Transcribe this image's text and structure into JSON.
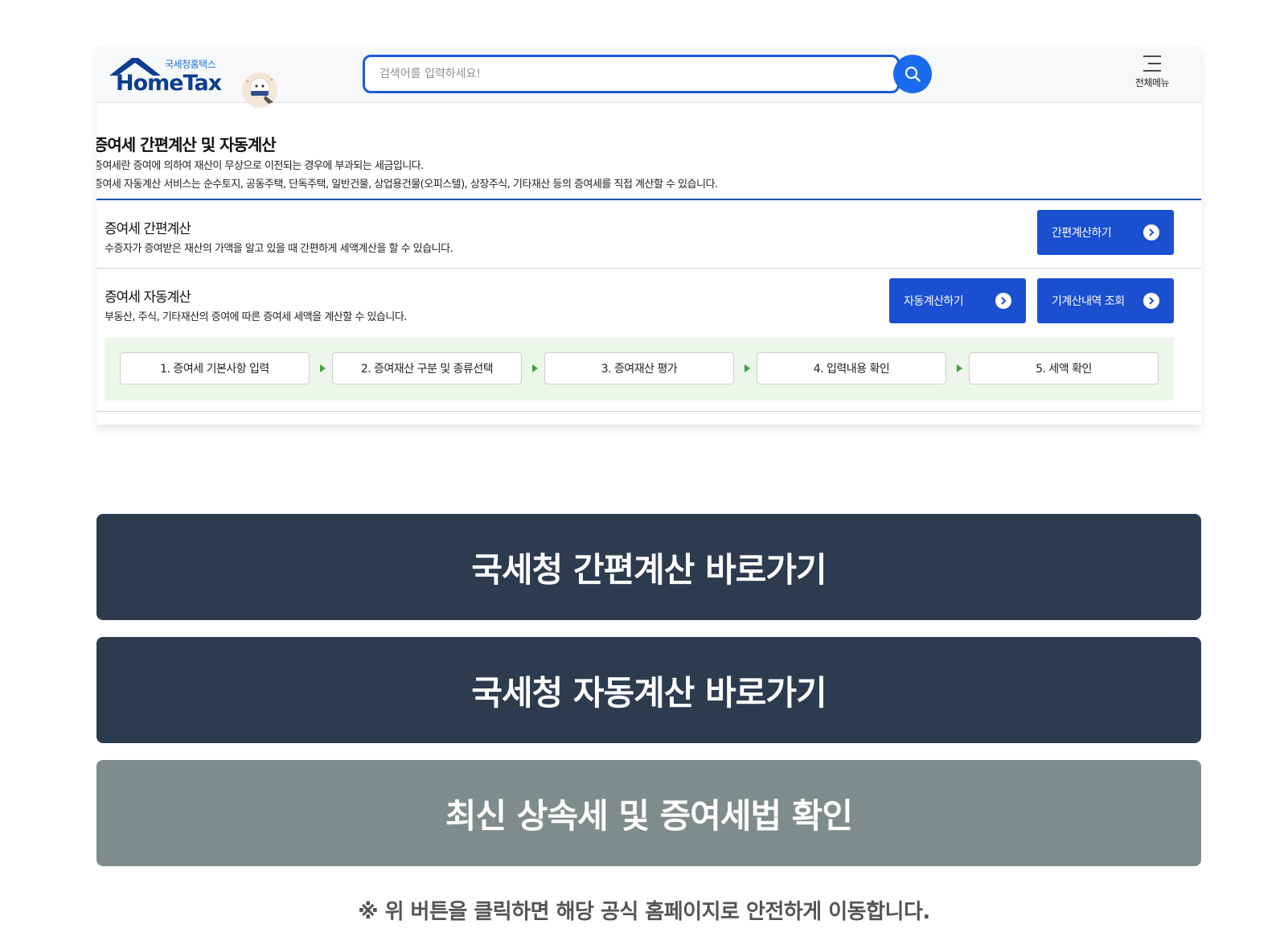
{
  "header": {
    "logo_sub": "국세청홈택스",
    "logo_main": "HomeTax",
    "search_placeholder": "검색어를 입력하세요!",
    "menu_label": "전체메뉴"
  },
  "intro": {
    "title": "증여세 간편계산 및 자동계산",
    "desc1": "증여세란 증여에 의하여 재산이 무상으로 이전되는 경우에 부과되는 세금입니다.",
    "desc2": "증여세 자동계산 서비스는 순수토지, 공동주택, 단독주택, 일반건물, 상업용건물(오피스텔), 상장주식, 기타재산 등의 증여세를 직접 계산할 수 있습니다."
  },
  "simple_calc": {
    "title": "증여세 간편계산",
    "desc": "수증자가 증여받은 재산의 가액을 알고 있을 때 간편하게 세액계산을 할 수 있습니다.",
    "button_label": "간편계산하기"
  },
  "auto_calc": {
    "title": "증여세 자동계산",
    "desc": "부동산, 주식, 기타재산의 증여에 따른 증여세 세액을 계산할 수 있습니다.",
    "button_label": "자동계산하기",
    "history_label": "기계산내역 조회"
  },
  "steps": [
    "1. 증여세 기본사항 입력",
    "2. 증여재산 구분 및 종류선택",
    "3. 증여재산 평가",
    "4. 입력내용 확인",
    "5. 세액 확인"
  ],
  "links": {
    "simple": "국세청 간편계산 바로가기",
    "auto": "국세청 자동계산 바로가기",
    "law": "최신 상속세 및 증여세법 확인"
  },
  "notice": "※ 위 버튼을 클릭하면 해당 공식 홈페이지로 안전하게 이동합니다.",
  "colors": {
    "accent_blue": "#1a4fd0",
    "dark_button": "#2d3b4f",
    "grey_button": "#7f8c8c",
    "step_bg": "#edf6ea"
  }
}
